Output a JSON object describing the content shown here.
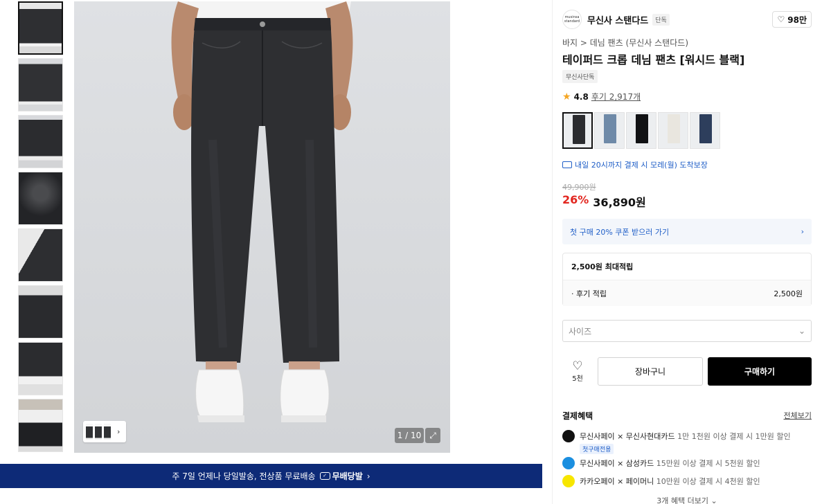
{
  "thumbnails": [
    {
      "name": "thumb-front-full"
    },
    {
      "name": "thumb-front-full-2"
    },
    {
      "name": "thumb-front-side"
    },
    {
      "name": "thumb-detail-waist"
    },
    {
      "name": "thumb-detail-pocket"
    },
    {
      "name": "thumb-detail-back"
    },
    {
      "name": "thumb-detail-hem"
    },
    {
      "name": "thumb-model-street"
    }
  ],
  "gallery": {
    "counter": "1 / 10",
    "expand_icon": "expand-icon",
    "strip_chevron": "›"
  },
  "banner": {
    "text": "주 7일 언제나 당일발송, 전상품 무료배송",
    "service": "무배당발",
    "chevron": "›"
  },
  "product": {
    "brand_logo_text": "musinsa standard",
    "brand": "무신사 스탠다드",
    "brand_badge": "단독",
    "likes": "98만",
    "breadcrumb": "바지 > 데님 팬츠 (무신사 스탠다드)",
    "title": "테이퍼드 크롭 데님 팬츠 [워시드 블랙]",
    "exclusive_tag": "무신사단독",
    "rating": "4.8",
    "reviews": "후기 2,917개",
    "swatch_colors": [
      "#2b2c2f",
      "#6f8aa8",
      "#111214",
      "#e9e6df",
      "#2d3e5c"
    ],
    "delivery": "내일 20시까지 결제 시 모레(월) 도착보장",
    "original_price": "49,900원",
    "discount": "26%",
    "price": "36,890원"
  },
  "coupon": {
    "text": "첫 구매 20% 쿠폰 받으러 가기",
    "chevron": "›"
  },
  "points": {
    "headline": "2,500원 최대적립",
    "row_label": "· 후기 적립",
    "row_value": "2,500원"
  },
  "size_select": {
    "placeholder": "사이즈",
    "chevron": "⌄"
  },
  "actions": {
    "heart_count": "5천",
    "cart": "장바구니",
    "buy": "구매하기"
  },
  "benefits": {
    "title": "결제혜택",
    "view_all": "전체보기",
    "items": [
      {
        "label": "무신사페이 × 무신사현대카드",
        "desc": "1만 1천원 이상 결제 시 1만원 할인",
        "tag": "첫구매전용",
        "color": "#111111"
      },
      {
        "label": "무신사페이 × 삼성카드",
        "desc": "15만원 이상 결제 시 5천원 할인",
        "tag": "",
        "color": "#1b8fe0"
      },
      {
        "label": "카카오페이 × 페이머니",
        "desc": "10만원 이상 결제 시 4천원 할인",
        "tag": "",
        "color": "#f7e600"
      }
    ],
    "more": "3개 혜택 더보기 ⌄"
  }
}
